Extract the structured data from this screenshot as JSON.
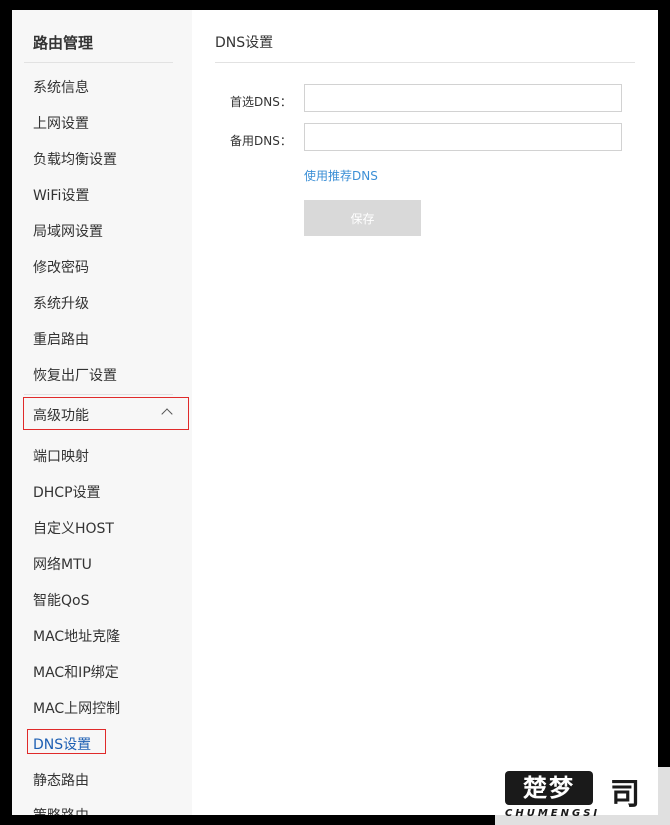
{
  "sidebar": {
    "title": "路由管理",
    "items": [
      {
        "label": "系统信息"
      },
      {
        "label": "上网设置"
      },
      {
        "label": "负载均衡设置"
      },
      {
        "label": "WiFi设置"
      },
      {
        "label": "局域网设置"
      },
      {
        "label": "修改密码"
      },
      {
        "label": "系统升级"
      },
      {
        "label": "重启路由"
      },
      {
        "label": "恢复出厂设置"
      }
    ],
    "group": {
      "label": "高级功能",
      "expanded": true,
      "items": [
        {
          "label": "端口映射"
        },
        {
          "label": "DHCP设置"
        },
        {
          "label": "自定义HOST"
        },
        {
          "label": "网络MTU"
        },
        {
          "label": "智能QoS"
        },
        {
          "label": "MAC地址克隆"
        },
        {
          "label": "MAC和IP绑定"
        },
        {
          "label": "MAC上网控制"
        },
        {
          "label": "DNS设置"
        },
        {
          "label": "静态路由"
        },
        {
          "label": "策略路由"
        }
      ],
      "active_item": "DNS设置"
    }
  },
  "main": {
    "title": "DNS设置",
    "primary_dns": {
      "label": "首选DNS：",
      "value": ""
    },
    "secondary_dns": {
      "label": "备用DNS：",
      "value": ""
    },
    "recommend_link": "使用推荐DNS",
    "save_button": "保存"
  },
  "watermark": {
    "logo_text": "楚梦",
    "glyph": "司",
    "sub_text": "CHUMENGSI"
  },
  "colors": {
    "accent": "#1d5fb3",
    "link": "#3b8fd6",
    "highlight_border": "#e02a2a",
    "button_disabled": "#d9d9d9",
    "sidebar_bg": "#f7f7f7"
  }
}
